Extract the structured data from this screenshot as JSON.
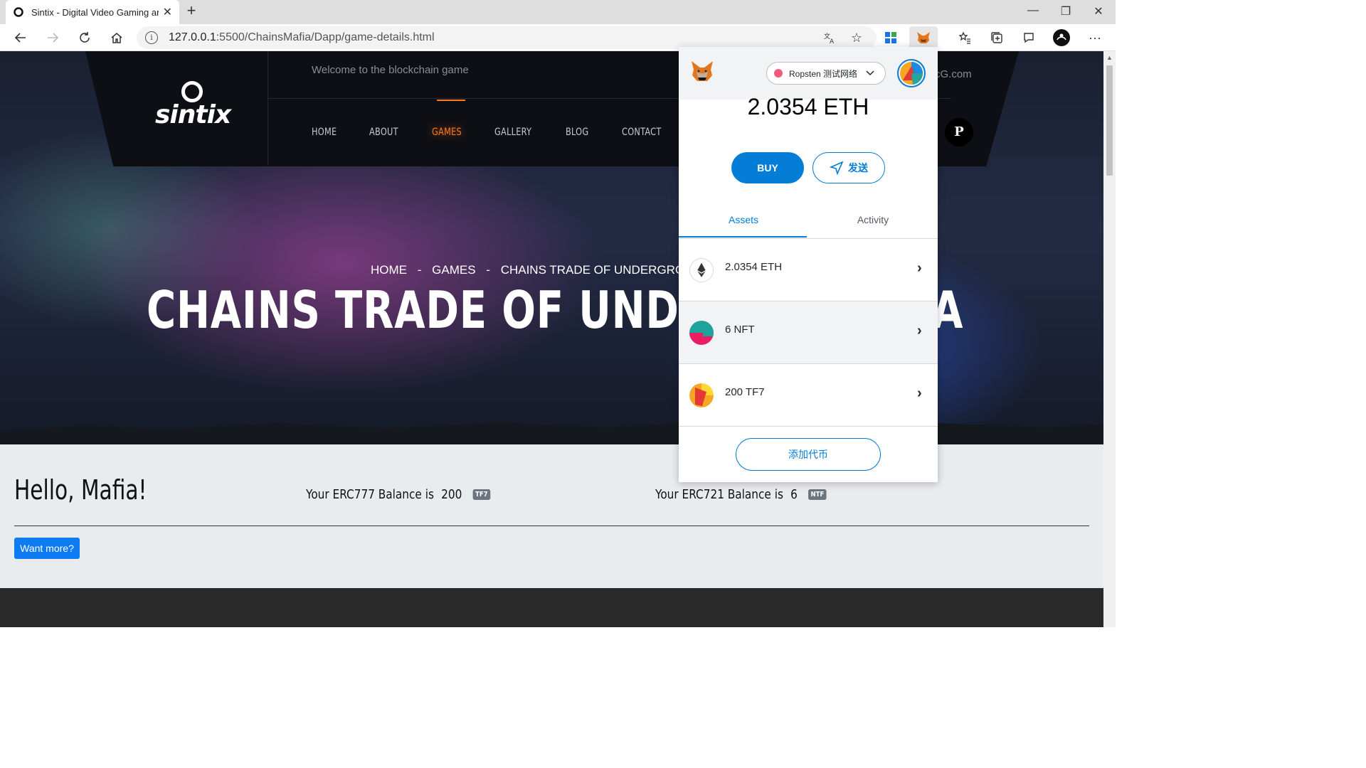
{
  "browser": {
    "tab_title": "Sintix - Digital Video Gaming and",
    "url_host": "127.0.0.1",
    "url_path": ":5500/ChainsMafia/Dapp/game-details.html"
  },
  "site": {
    "logo_text": "sintix",
    "welcome": "Welcome to the blockchain game",
    "email_partial": "cG.com",
    "nav": [
      {
        "label": "HOME"
      },
      {
        "label": "ABOUT"
      },
      {
        "label": "GAMES"
      },
      {
        "label": "GALLERY"
      },
      {
        "label": "BLOG"
      },
      {
        "label": "CONTACT"
      }
    ],
    "breadcrumb": [
      "HOME",
      "-",
      "GAMES",
      "-",
      "CHAINS TRADE OF UNDERGROU"
    ],
    "title": "CHAINS TRADE OF UNDERG",
    "title_tail": "A"
  },
  "content": {
    "greeting": "Hello, Mafia!",
    "erc777_label": "Your ERC777 Balance is",
    "erc777_value": "200",
    "erc777_badge": "TF7",
    "erc721_label": "Your ERC721 Balance is",
    "erc721_value": "6",
    "erc721_badge": "NTF",
    "more_button": "Want more?"
  },
  "metamask": {
    "network": "Ropsten 测试网络",
    "balance": "2.0354 ETH",
    "buy": "BUY",
    "send": "发送",
    "tabs": [
      "Assets",
      "Activity"
    ],
    "assets": [
      {
        "label": "2.0354 ETH"
      },
      {
        "label": "6 NFT"
      },
      {
        "label": "200 TF7"
      }
    ],
    "add_token": "添加代币"
  },
  "colors": {
    "accent_orange": "#ff7a1a",
    "metamask_blue": "#037dd6",
    "button_blue": "#0d7cf2"
  }
}
